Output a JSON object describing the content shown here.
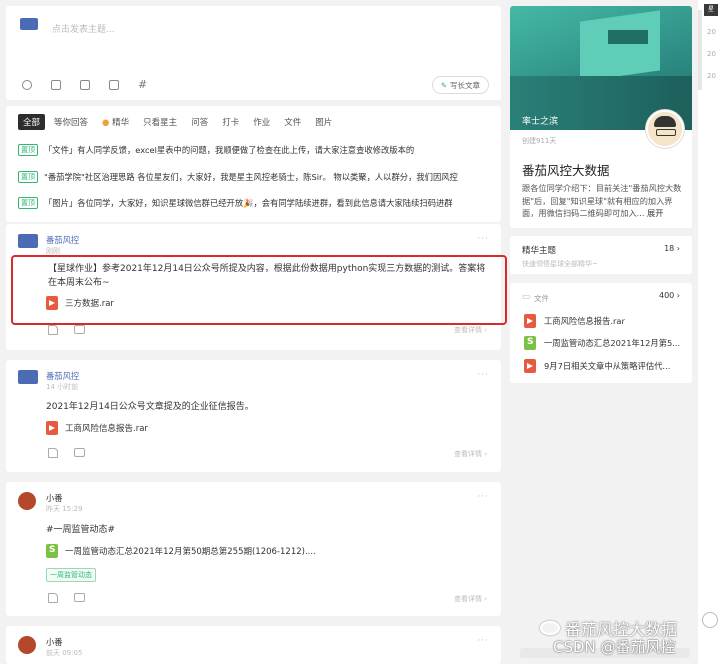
{
  "composer": {
    "placeholder": "点击发表主题...",
    "long_article": "写长文章"
  },
  "filters": [
    "全部",
    "等你回答",
    "精华",
    "只看星主",
    "问答",
    "打卡",
    "作业",
    "文件",
    "图片"
  ],
  "pinned_tag": "置顶",
  "pinned": [
    "「文件」有人同学反馈，excel星表中的问题，我顺便做了检查在此上传，请大家注意查收修改版本的",
    "\"番茄学院\"社区治理思路 各位星友们，大家好，我是星主风控老骑士，陈Sir。 物以类聚，人以群分，我们因风控",
    "「图片」各位同学，大家好，知识星球微信群已经开放🎉，会有同学陆续进群，看到此信息请大家陆续扫码进群"
  ],
  "posts": [
    {
      "author": "番茄风控",
      "time": "刚刚",
      "text": "【星球作业】参考2021年12月14日公众号所提及内容，根据此份数据用python实现三方数据的测试。答案将在本周末公布~",
      "file": "三方数据.rar",
      "detail": "查看详情 ›"
    },
    {
      "author": "番茄风控",
      "time": "14 小时前",
      "text": "2021年12月14日公众号文章提及的企业征信报告。",
      "file": "工商风险信息报告.rar",
      "detail": "查看详情 ›"
    },
    {
      "author": "小番",
      "time": "昨天 15:29",
      "text": "#一周监管动态#",
      "file": "一周监管动态汇总2021年12月第50期总第255期(1206-1212)....",
      "tag": "一周监管动态",
      "detail": "查看详情 ›"
    },
    {
      "author": "小番",
      "time": "前天 09:05"
    }
  ],
  "group": {
    "hero_label": "率士之滨",
    "created": "创建911天",
    "name": "番茄风控大数据",
    "desc": "跟各位同学介绍下：目前关注\"番茄风控大数据\"后，回复\"知识星球\"就有相应的加入界面，用微信扫码二维码即可加入... ",
    "expand": "展开"
  },
  "featured": {
    "title": "精华主题",
    "count": "18 ›",
    "sub": "快速领悟星球全部精华~"
  },
  "files": {
    "title": "文件",
    "count": "400 ›",
    "items": [
      "工商风险信息报告.rar",
      "一周监管动态汇总2021年12月第5...",
      "9月7日相关文章中从策略评估代..."
    ]
  },
  "strip": {
    "top": "星",
    "items": [
      "20",
      "20",
      "20"
    ]
  },
  "watermark": {
    "line1": "番茄风控大数据",
    "line2": "CSDN @番茄风控"
  }
}
